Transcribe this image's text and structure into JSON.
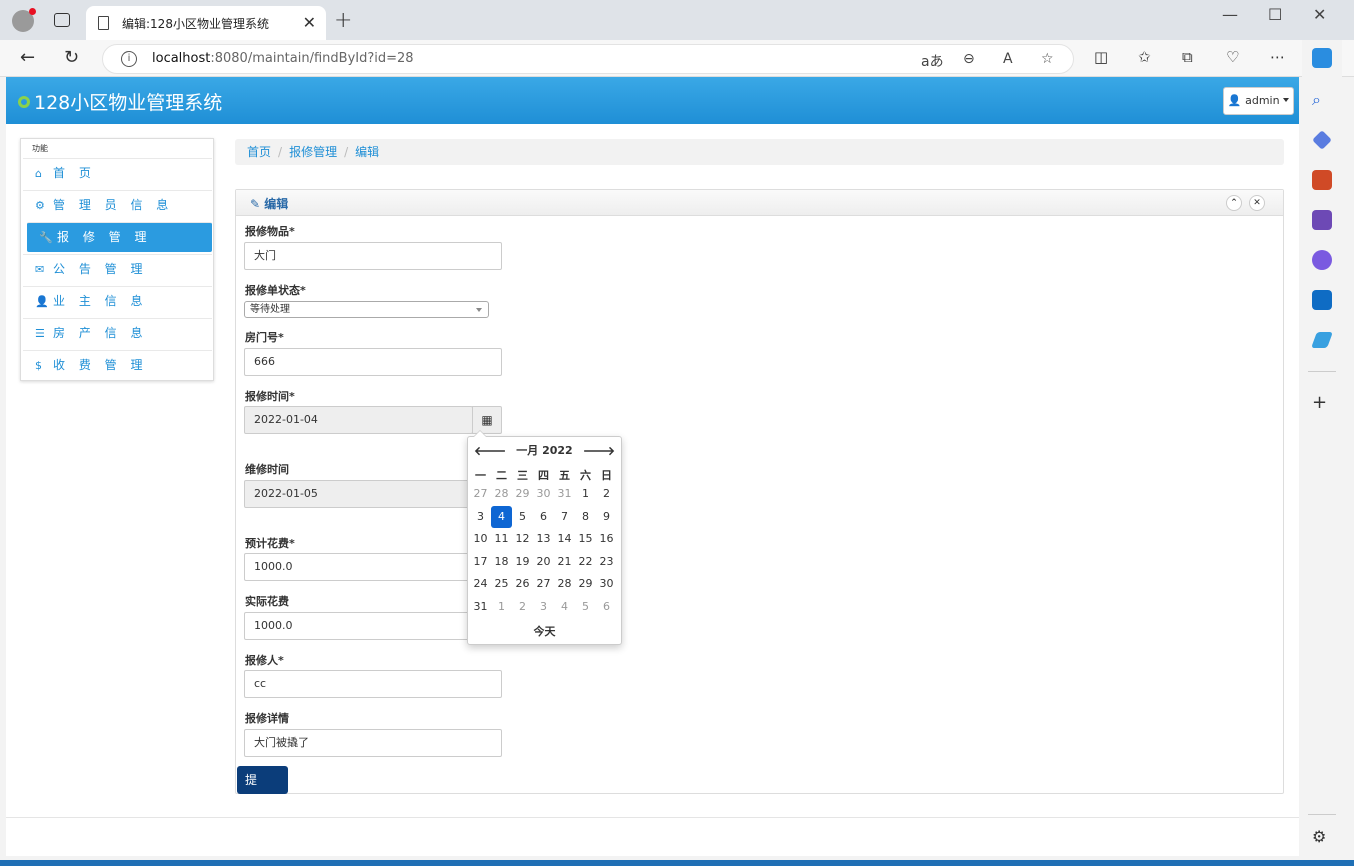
{
  "browser": {
    "tab_title": "编辑:128小区物业管理系统",
    "url_host": "localhost",
    "url_path": ":8080/maintain/findById?id=28"
  },
  "app": {
    "brand": "128小区物业管理系统",
    "user": "admin"
  },
  "menu": {
    "title": "功能",
    "items": [
      {
        "label": "首 页",
        "icon": "home-icon"
      },
      {
        "label": "管 理 员 信 息",
        "icon": "cog-icon"
      },
      {
        "label": "报 修 管 理",
        "icon": "wrench-icon"
      },
      {
        "label": "公 告 管 理",
        "icon": "envelope-icon"
      },
      {
        "label": "业 主 信 息",
        "icon": "user-icon"
      },
      {
        "label": "房 产 信 息",
        "icon": "list-icon"
      },
      {
        "label": "收 费 管 理",
        "icon": "dollar-icon"
      }
    ]
  },
  "breadcrumb": [
    "首页",
    "报修管理",
    "编辑"
  ],
  "panel": {
    "title": "编辑"
  },
  "form": {
    "item_label": "报修物品*",
    "item_value": "大门",
    "status_label": "报修单状态*",
    "status_value": "等待处理",
    "room_label": "房门号*",
    "room_value": "666",
    "report_time_label": "报修时间*",
    "report_time_value": "2022-01-04",
    "repair_time_label": "维修时间",
    "repair_time_value": "2022-01-05",
    "est_cost_label": "预计花费*",
    "est_cost_value": "1000.0",
    "actual_cost_label": "实际花费",
    "actual_cost_value": "1000.0",
    "reporter_label": "报修人*",
    "reporter_value": "cc",
    "detail_label": "报修详情",
    "detail_value": "大门被撬了",
    "submit": "提 交"
  },
  "datepicker": {
    "header": "一月 2022",
    "weekdays": [
      "一",
      "二",
      "三",
      "四",
      "五",
      "六",
      "日"
    ],
    "weeks": [
      [
        "27",
        "28",
        "29",
        "30",
        "31",
        "1",
        "2"
      ],
      [
        "3",
        "4",
        "5",
        "6",
        "7",
        "8",
        "9"
      ],
      [
        "10",
        "11",
        "12",
        "13",
        "14",
        "15",
        "16"
      ],
      [
        "17",
        "18",
        "19",
        "20",
        "21",
        "22",
        "23"
      ],
      [
        "24",
        "25",
        "26",
        "27",
        "28",
        "29",
        "30"
      ],
      [
        "31",
        "1",
        "2",
        "3",
        "4",
        "5",
        "6"
      ]
    ],
    "selected": "4",
    "today_label": "今天"
  }
}
